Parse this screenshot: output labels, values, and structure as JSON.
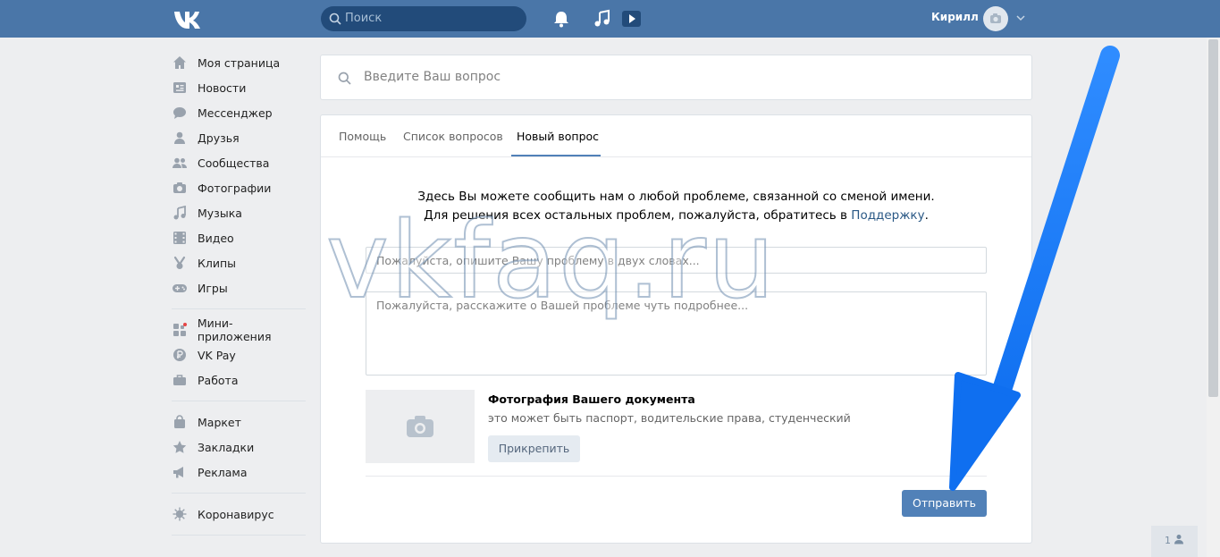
{
  "colors": {
    "header_bg": "#4a76a8",
    "accent": "#5181b8",
    "link": "#2a5885",
    "arrow": "#1a7cf5"
  },
  "header": {
    "logo": "vk-logo-icon",
    "search_placeholder": "Поиск",
    "user_name": "Кирилл",
    "icons": [
      "bell-icon",
      "music-icon",
      "video-play-icon",
      "camera-icon",
      "chevron-down-icon"
    ]
  },
  "sidebar": {
    "group1": [
      {
        "label": "Моя страница",
        "icon": "home-icon"
      },
      {
        "label": "Новости",
        "icon": "news-icon"
      },
      {
        "label": "Мессенджер",
        "icon": "chat-icon"
      },
      {
        "label": "Друзья",
        "icon": "user-icon"
      },
      {
        "label": "Сообщества",
        "icon": "users-icon"
      },
      {
        "label": "Фотографии",
        "icon": "camera-icon"
      },
      {
        "label": "Музыка",
        "icon": "music-icon"
      },
      {
        "label": "Видео",
        "icon": "film-icon"
      },
      {
        "label": "Клипы",
        "icon": "clips-icon"
      },
      {
        "label": "Игры",
        "icon": "gamepad-icon"
      }
    ],
    "group2": [
      {
        "label": "Мини-приложения",
        "icon": "apps-icon"
      },
      {
        "label": "VK Pay",
        "icon": "vkpay-icon"
      },
      {
        "label": "Работа",
        "icon": "briefcase-icon"
      }
    ],
    "group3": [
      {
        "label": "Маркет",
        "icon": "bag-icon"
      },
      {
        "label": "Закладки",
        "icon": "star-icon"
      },
      {
        "label": "Реклама",
        "icon": "megaphone-icon"
      }
    ],
    "group4": [
      {
        "label": "Коронавирус",
        "icon": "virus-icon"
      }
    ]
  },
  "question_search": {
    "placeholder": "Введите Ваш вопрос"
  },
  "tabs": [
    {
      "label": "Помощь",
      "active": false
    },
    {
      "label": "Список вопросов",
      "active": false
    },
    {
      "label": "Новый вопрос",
      "active": true
    }
  ],
  "intro": {
    "line1": "Здесь Вы можете сообщить нам о любой проблеме, связанной со сменой имени.",
    "line2_prefix": "Для решения всех остальных проблем, пожалуйста, обратитесь в",
    "line2_link": "Поддержку",
    "line2_suffix": "."
  },
  "form": {
    "title_placeholder": "Пожалуйста, опишите Вашу проблему в двух словах...",
    "body_placeholder": "Пожалуйста, расскажите о Вашей проблеме чуть подробнее...",
    "doc_title": "Фотография Вашего документа",
    "doc_subtitle": "это может быть паспорт, водительские права, студенческий",
    "attach_label": "Прикрепить",
    "submit_label": "Отправить"
  },
  "watermark": "vkfaq.ru",
  "corner_widget": {
    "count": "1"
  }
}
